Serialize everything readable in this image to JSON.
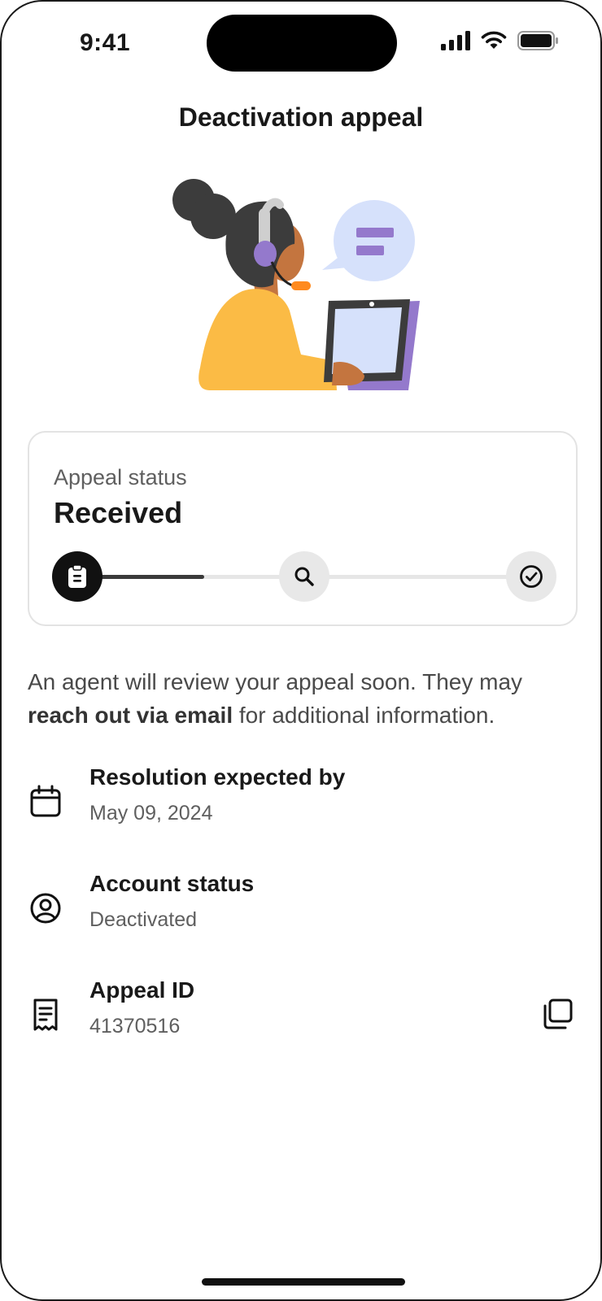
{
  "status_bar": {
    "time": "9:41",
    "signal_icon": "cellular-signal-icon",
    "wifi_icon": "wifi-icon",
    "battery_icon": "battery-icon"
  },
  "header": {
    "title": "Deactivation appeal"
  },
  "illustration": {
    "name": "support-agent-illustration"
  },
  "appeal_status": {
    "label": "Appeal status",
    "value": "Received",
    "progress_fraction": 0.28,
    "steps": [
      {
        "name": "received",
        "icon": "clipboard-icon",
        "active": true
      },
      {
        "name": "in-review",
        "icon": "search-icon",
        "active": false
      },
      {
        "name": "resolved",
        "icon": "check-circle-icon",
        "active": false
      }
    ]
  },
  "description": {
    "part1": "An agent will review your appeal soon. They may",
    "bold": "reach out via email",
    "part2": " for additional information."
  },
  "details": [
    {
      "icon": "calendar-icon",
      "title": "Resolution expected by",
      "value": "May 09, 2024"
    },
    {
      "icon": "user-circle-icon",
      "title": "Account status",
      "value": "Deactivated"
    },
    {
      "icon": "receipt-icon",
      "title": "Appeal ID",
      "value": "41370516",
      "action_icon": "copy-icon"
    }
  ],
  "colors": {
    "accent_purple": "#9479cc",
    "bubble_blue": "#d6e1fb",
    "sweater_yellow": "#fbbb45",
    "dark": "#111111"
  }
}
